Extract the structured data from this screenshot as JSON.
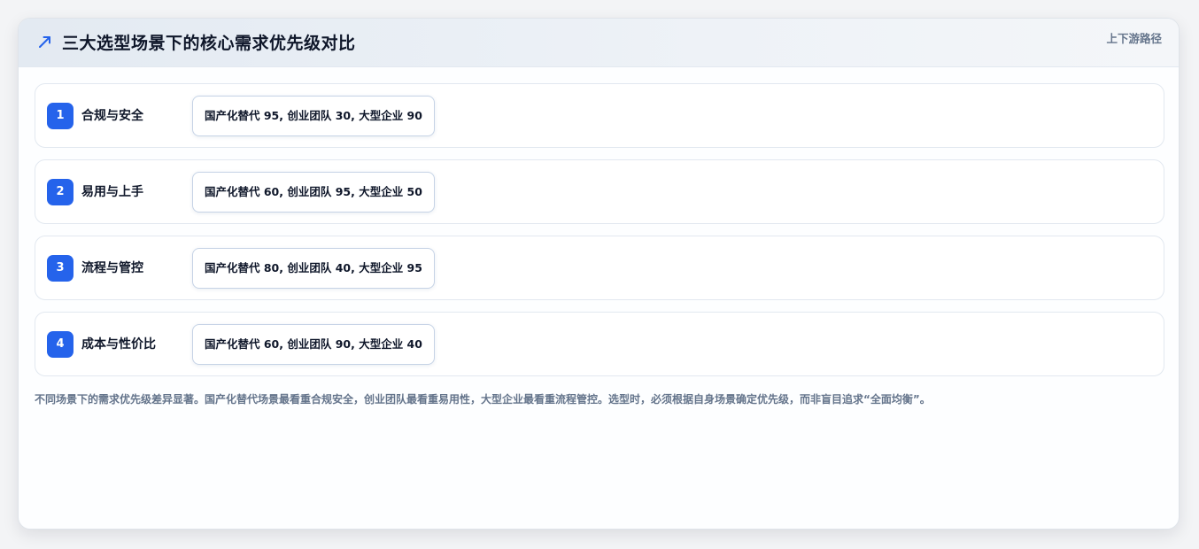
{
  "header": {
    "icon": "trend-arrow-icon",
    "title": "三大选型场景下的核心需求优先级对比",
    "tag": "上下游路径"
  },
  "rows": [
    {
      "index": "1",
      "label": "合规与安全",
      "value": "国产化替代 95, 创业团队 30, 大型企业 90"
    },
    {
      "index": "2",
      "label": "易用与上手",
      "value": "国产化替代 60, 创业团队 95, 大型企业 50"
    },
    {
      "index": "3",
      "label": "流程与管控",
      "value": "国产化替代 80, 创业团队 40, 大型企业 95"
    },
    {
      "index": "4",
      "label": "成本与性价比",
      "value": "国产化替代 60, 创业团队 90, 大型企业 40"
    }
  ],
  "summary": "不同场景下的需求优先级差异显著。国产化替代场景最看重合规安全，创业团队最看重易用性，大型企业最看重流程管控。选型时，必须根据自身场景确定优先级，而非盲目追求“全面均衡”。",
  "colors": {
    "accent": "#2563eb",
    "title": "#0f172a",
    "muted": "#64748b",
    "border": "#e2e8f0"
  }
}
